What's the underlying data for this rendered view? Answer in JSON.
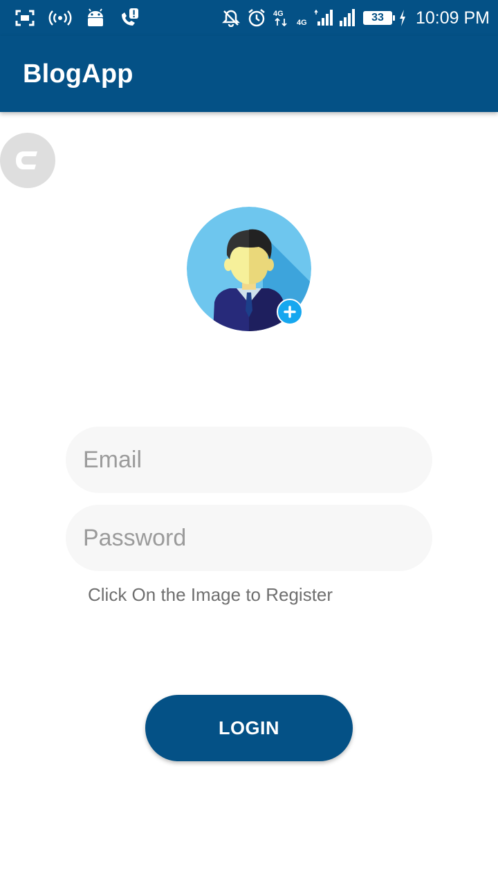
{
  "status_bar": {
    "time": "10:09 PM",
    "battery_level": "33",
    "network_label_1": "4G",
    "network_label_2": "4G",
    "icons_left": [
      "screenshot-icon",
      "hotspot-icon",
      "android-icon",
      "call-alert-icon"
    ],
    "icons_right": [
      "bell-off-icon",
      "alarm-icon",
      "data-arrows-icon",
      "signal-icon",
      "signal-icon",
      "battery-icon",
      "charging-icon"
    ]
  },
  "app_bar": {
    "title": "BlogApp"
  },
  "form": {
    "email_placeholder": "Email",
    "password_placeholder": "Password",
    "register_hint": "Click On the Image to Register",
    "login_label": "LOGIN"
  },
  "colors": {
    "primary": "#045186",
    "field_background": "#f7f7f7",
    "badge": "#16a7ef",
    "avatar_background": "#6ec6ee"
  }
}
